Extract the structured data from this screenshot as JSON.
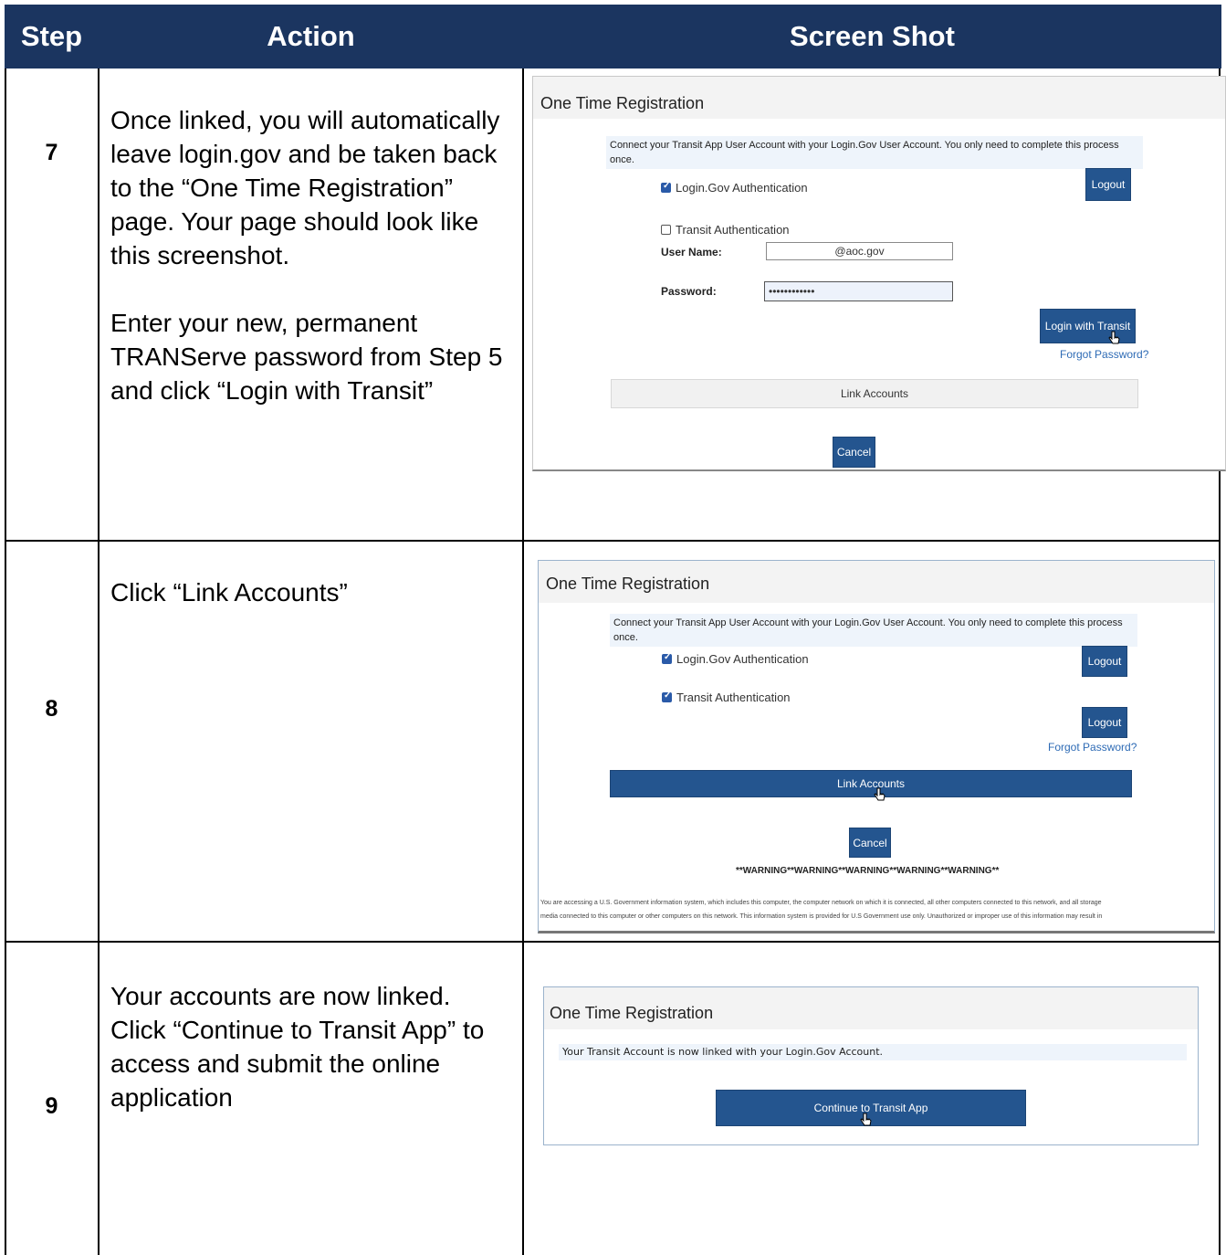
{
  "header": {
    "step": "Step",
    "action": "Action",
    "screenshot": "Screen Shot"
  },
  "rows": [
    {
      "step": "7",
      "action_paragraphs": [
        "Once linked, you will automatically leave login.gov and be taken back to the “One Time Registration” page. Your page should look like this screenshot.",
        "Enter your new, permanent TRANServe password from Step 5 and click “Login with Transit”"
      ],
      "shot": {
        "title": "One Time Registration",
        "intro": "Connect your Transit App User Account with your Login.Gov User Account. You only need to complete this process once.",
        "login_gov_auth": "Login.Gov Authentication",
        "logout": "Logout",
        "transit_auth": "Transit Authentication",
        "user_name_label": "User Name:",
        "user_name_value": "@aoc.gov",
        "password_label": "Password:",
        "password_value": "••••••••••••",
        "login_transit": "Login with Transit",
        "forgot_password": "Forgot Password?",
        "link_accounts": "Link Accounts",
        "cancel": "Cancel"
      }
    },
    {
      "step": "8",
      "action_paragraphs": [
        "Click “Link Accounts”"
      ],
      "shot": {
        "title": "One Time Registration",
        "intro": "Connect your Transit App User Account with your Login.Gov User Account. You only need to complete this process once.",
        "login_gov_auth": "Login.Gov Authentication",
        "logout_1": "Logout",
        "transit_auth": "Transit Authentication",
        "logout_2": "Logout",
        "forgot_password": "Forgot Password?",
        "link_accounts": "Link Accounts",
        "cancel": "Cancel",
        "warning": "**WARNING**WARNING**WARNING**WARNING**WARNING**",
        "fine_line_1": "You are accessing a U.S. Government information system, which includes this computer, the computer network on which it is connected, all other computers connected to this network, and all storage",
        "fine_line_2": "media connected to this computer or other computers on this network. This information system is provided for U.S Government use only. Unauthorized or improper use of this information may result in"
      }
    },
    {
      "step": "9",
      "action_paragraphs": [
        "Your accounts are now linked. Click “Continue to Transit App” to access and submit the online application"
      ],
      "shot": {
        "title": "One Time Registration",
        "message": "Your Transit Account is now linked with your Login.Gov Account.",
        "continue": "Continue to Transit App"
      }
    }
  ],
  "colors": {
    "header_bg": "#1b3560",
    "button_bg": "#24558f",
    "link": "#2e6bb5"
  }
}
